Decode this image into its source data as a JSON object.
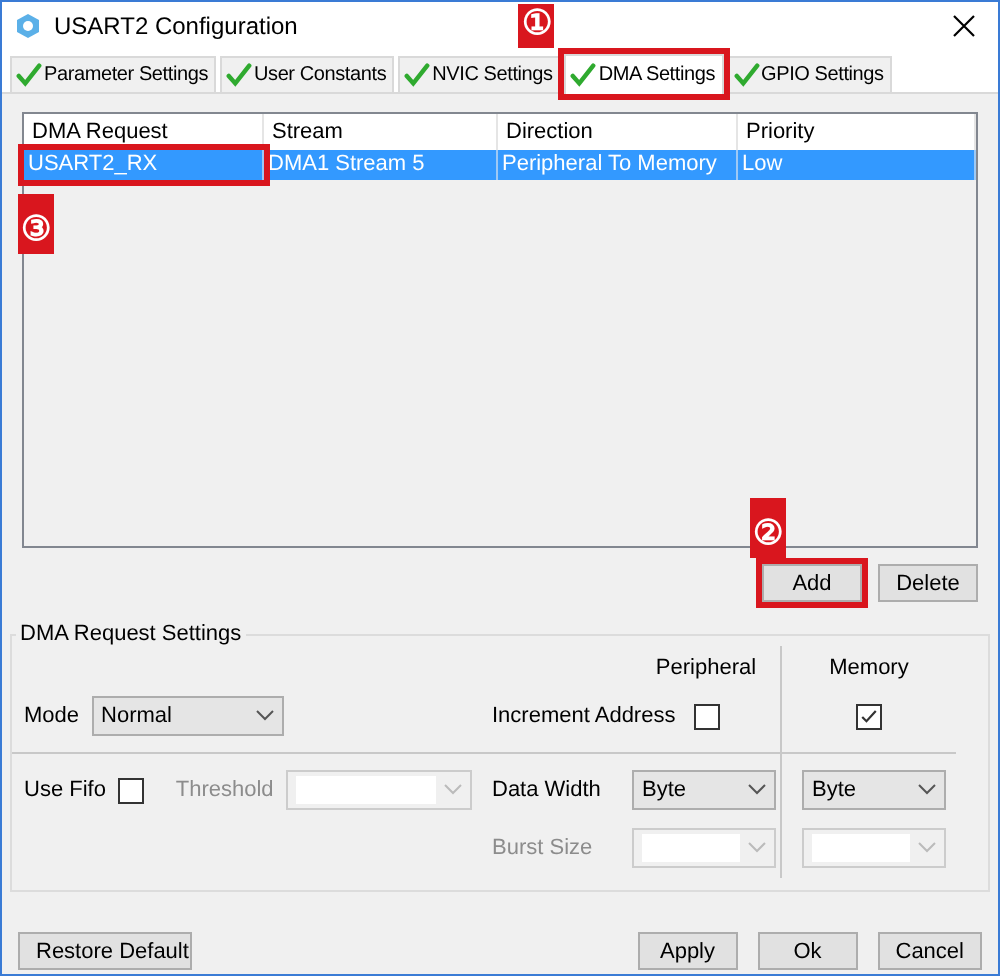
{
  "window": {
    "title": "USART2 Configuration"
  },
  "tabs": [
    {
      "label": "Parameter Settings",
      "selected": false
    },
    {
      "label": "User Constants",
      "selected": false
    },
    {
      "label": "NVIC Settings",
      "selected": false
    },
    {
      "label": "DMA Settings",
      "selected": true
    },
    {
      "label": "GPIO Settings",
      "selected": false
    }
  ],
  "table": {
    "columns": [
      "DMA Request",
      "Stream",
      "Direction",
      "Priority"
    ],
    "rows": [
      {
        "cells": [
          "USART2_RX",
          "DMA1 Stream 5",
          "Peripheral To Memory",
          "Low"
        ],
        "selected": true
      }
    ]
  },
  "list_buttons": [
    "Add",
    "Delete"
  ],
  "request_settings": {
    "title": "DMA Request Settings",
    "peripheral_header": "Peripheral",
    "memory_header": "Memory",
    "mode": {
      "label": "Mode",
      "value": "Normal"
    },
    "increment_address": {
      "label": "Increment Address",
      "peripheral_checked": false,
      "memory_checked": true
    },
    "use_fifo": {
      "label": "Use Fifo",
      "checked": false
    },
    "threshold": {
      "label": "Threshold",
      "disabled": true
    },
    "data_width": {
      "label": "Data Width",
      "peripheral_value": "Byte",
      "memory_value": "Byte"
    },
    "burst_size": {
      "label": "Burst Size",
      "disabled": true
    }
  },
  "footer_buttons": [
    "Restore Default",
    "Apply",
    "Ok",
    "Cancel"
  ],
  "annotations": [
    {
      "label": "①"
    },
    {
      "label": "②"
    },
    {
      "label": "③"
    }
  ]
}
